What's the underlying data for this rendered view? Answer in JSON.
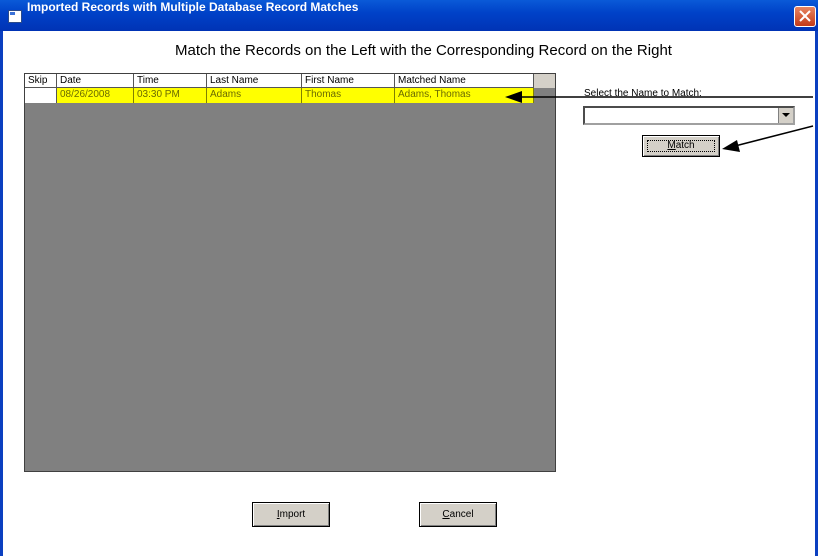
{
  "window": {
    "title": "Imported Records with Multiple Database Record Matches",
    "icon": "window-icon",
    "close_icon": "close-icon"
  },
  "heading": "Match the Records on the Left with the Corresponding Record on the Right",
  "grid": {
    "columns": [
      "Skip",
      "Date",
      "Time",
      "Last Name",
      "First Name",
      "Matched Name"
    ],
    "rows": [
      {
        "skip": "",
        "date": "08/26/2008",
        "time": "03:30 PM",
        "last_name": "Adams",
        "first_name": "Thomas",
        "matched_name": "Adams, Thomas",
        "highlight": "#ffff00"
      }
    ]
  },
  "select": {
    "label": "Select the Name to Match:",
    "value": ""
  },
  "buttons": {
    "match": "Match",
    "import": "Import",
    "cancel": "Cancel"
  },
  "colors": {
    "titlebar": "#0042c8",
    "grid_background": "#808080",
    "row_highlight": "#ffff00"
  }
}
